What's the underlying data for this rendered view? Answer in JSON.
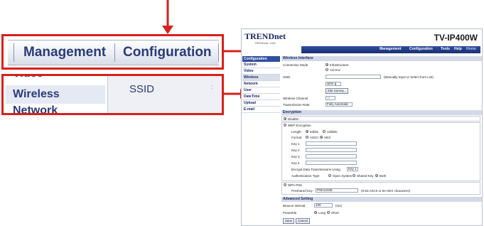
{
  "callout_top": {
    "tabs": [
      "Management",
      "Configuration"
    ]
  },
  "callout_bottom": {
    "left_items": [
      "Video",
      "Wireless",
      "Network"
    ],
    "right_label": "SSID"
  },
  "camera": {
    "brand": "TRENDnet",
    "brand_sub": "TRENDnet, USA",
    "model": "TV-IP400W",
    "topnav": [
      "Management",
      "Configuration",
      "Tools",
      "Help",
      "Home"
    ],
    "sidebar_title": "Configuration",
    "sidebar": [
      "System",
      "Video",
      "Wireless",
      "Network",
      "User",
      "DateTime",
      "Upload",
      "E-mail"
    ],
    "wireless": {
      "section": "Wireless Interface",
      "conn_label": "Connection Mode",
      "infra": "Infrastructure",
      "adhoc": "Ad-Hoc",
      "ssid_label": "SSID",
      "ssid_hint": "(Manually Input or Select from List)",
      "band": "wlan-g",
      "site_survey": "Site Survey...",
      "channel_label": "Wireless Channel",
      "channel_value": "11",
      "rate_label": "Transmission Rate",
      "rate_value": "Fully Automatic"
    },
    "encryption": {
      "section": "Encryption",
      "disable": "Disable",
      "wep": "WEP Encryption",
      "length_label": "Length",
      "len64": "64bits",
      "len128": "128bits",
      "format_label": "Format",
      "ascii": "ASCII",
      "hex": "HEX",
      "key1": "Key 1",
      "key2": "Key 2",
      "key3": "Key 3",
      "key4": "Key 4",
      "encrypt_using": "Encrypt Data Transmissions Using",
      "encrypt_key": "Key 1",
      "auth_label": "Authentication Type",
      "open": "Open System",
      "shared": "Shared Key",
      "both": "Both",
      "wpa": "WPA-PSK",
      "psk_label": "Preshared Key",
      "psk_value": "PSK12345",
      "psk_hint": "(8-63 ASCII or 64 HEX characters)"
    },
    "advanced": {
      "section": "Advanced Setting",
      "beacon_label": "Beacon Interval",
      "beacon_value": "100",
      "beacon_unit": "(ms)",
      "preamble_label": "Preamble",
      "long": "Long",
      "short": "Short"
    },
    "buttons": {
      "save": "Save",
      "cancel": "Cancel"
    }
  }
}
